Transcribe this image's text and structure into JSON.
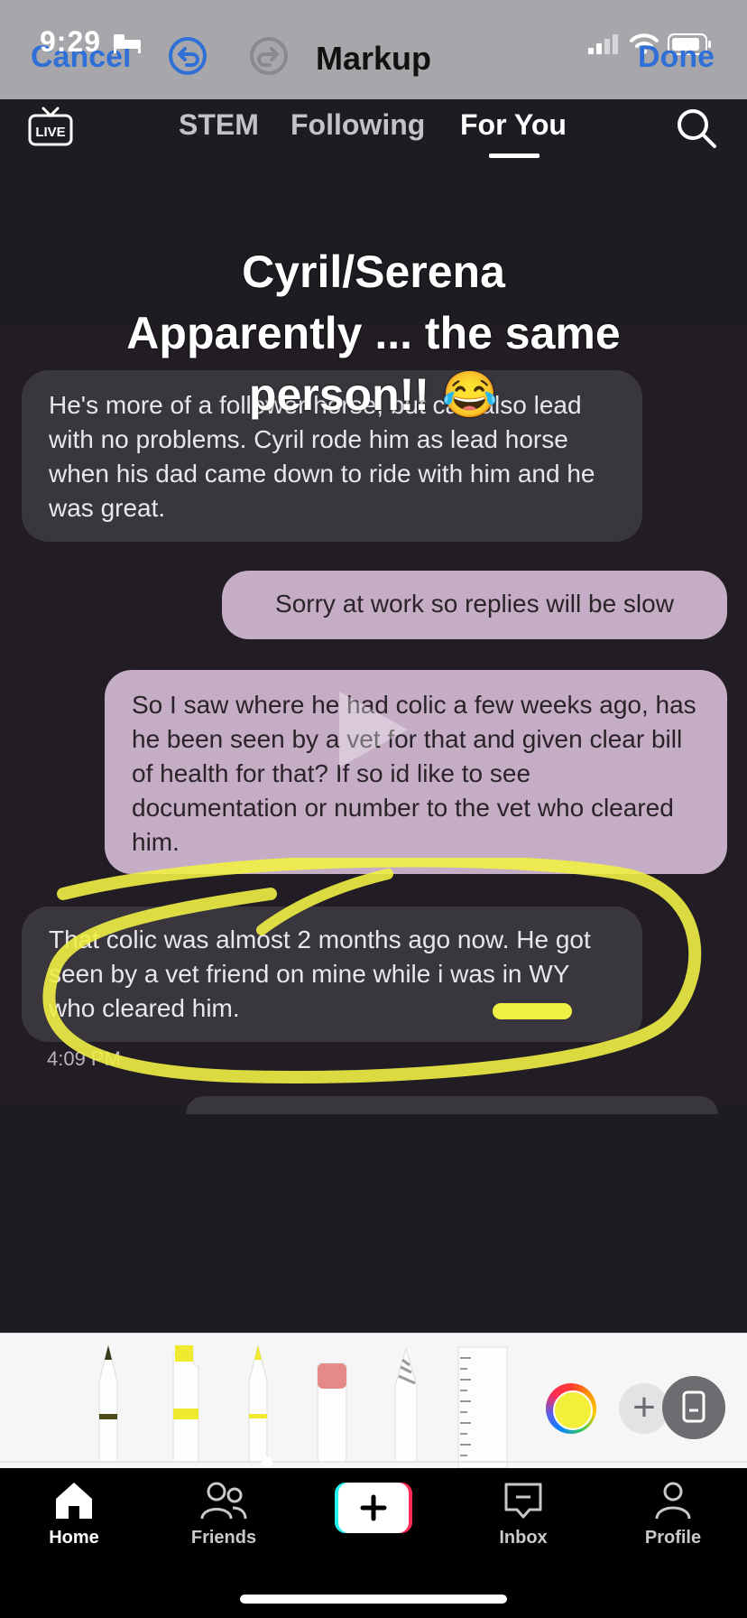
{
  "status_bar": {
    "time": "9:29"
  },
  "markup_bar": {
    "cancel_label": "Cancel",
    "title": "Markup",
    "done_label": "Done"
  },
  "feed_tabs": {
    "stem": "STEM",
    "following": "Following",
    "for_you": "For You",
    "live": "LIVE"
  },
  "video": {
    "overlay_lines": [
      "Cyril/Serena",
      "Apparently ... the same",
      "person!! 😂"
    ],
    "messages": [
      {
        "text": "He's more of a follower horse, but can also lead with no problems. Cyril rode him as lead horse when his dad came down to ride with him and he was great."
      },
      {
        "text": "Sorry at work so replies will be slow"
      },
      {
        "text": "So I saw where he had colic a few weeks ago, has he been seen by a vet for that and given clear bill of health for that? If so id like to see documentation or number to the vet who cleared him."
      },
      {
        "text": "That colic was almost 2 months ago now. He got seen by a vet friend on mine while i was in WY who cleared him."
      }
    ],
    "timestamp": "4:09 PM"
  },
  "palette": {
    "selected_color": "#f4ef3a",
    "highlight_color": "#f0f044"
  },
  "nav": {
    "home": "Home",
    "friends": "Friends",
    "inbox": "Inbox",
    "profile": "Profile"
  }
}
